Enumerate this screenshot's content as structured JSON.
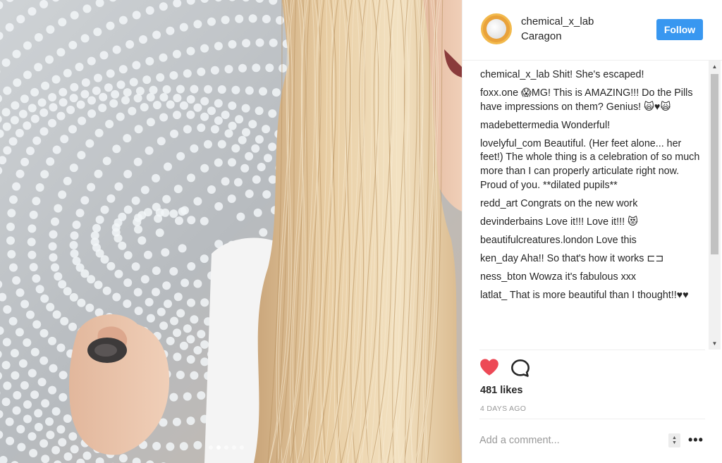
{
  "post": {
    "username": "chemical_x_lab",
    "location": "Caragon",
    "follow_label": "Follow",
    "likes": "481 likes",
    "timestamp": "4 DAYS AGO",
    "add_comment_placeholder": "Add a comment...",
    "more_label": "•••"
  },
  "comments": [
    {
      "user": "chemical_x_lab",
      "text": "Shit! She's escaped!"
    },
    {
      "user": "foxx.one",
      "text": "😱MG! This is AMAZING!!! Do the Pills have impressions on them? Genius! 🙀♥🙀"
    },
    {
      "user": "madebettermedia",
      "text": "Wonderful!"
    },
    {
      "user": "lovelyful_com",
      "text": "Beautiful. (Her feet alone... her feet!) The whole thing is a celebration of so much more than I can properly articulate right now. Proud of you. **dilated pupils**"
    },
    {
      "user": "redd_art",
      "text": "Congrats on the new work"
    },
    {
      "user": "devinderbains",
      "text": "Love it!!! Love it!!! 😻"
    },
    {
      "user": "beautifulcreatures.london",
      "text": "Love this"
    },
    {
      "user": "ken_day",
      "text": "Aha!! So that's how it works ⊏⊐"
    },
    {
      "user": "ness_bton",
      "text": "Wowza it's fabulous xxx"
    },
    {
      "user": "latlat_",
      "text": "That is more beautiful than I thought!!♥♥"
    }
  ],
  "carousel": {
    "count": 5,
    "active_index": 1
  },
  "icons": {
    "like": "heart-icon",
    "comment": "speech-bubble-icon",
    "scroll_up": "triangle-up-icon",
    "scroll_down": "triangle-down-icon"
  },
  "colors": {
    "follow_button": "#3897f0",
    "heart": "#ed4956",
    "avatar_ring": "#e9a23b",
    "timestamp": "#999999"
  }
}
